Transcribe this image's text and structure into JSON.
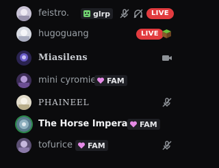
{
  "voice_users": [
    {
      "name": "feistro.",
      "tag": "glrp",
      "live": "LIVE"
    },
    {
      "name": "hugoguang",
      "live": "LIVE"
    },
    {
      "name": "Miasilens"
    },
    {
      "name": "mini cyromie",
      "tag": "FAM"
    },
    {
      "name": "PHAINEEL"
    },
    {
      "name": "The Horse Imperator",
      "tag": "FAM"
    },
    {
      "name": "tofurice",
      "tag": "FAM"
    }
  ],
  "colors": {
    "live": "#e23b3f",
    "speaking_ring": "#2b8a4a",
    "heart_tag": "#e58ae6",
    "cat_tag": "#6fcf6f"
  },
  "icons": [
    "cat-face-icon",
    "heart-icon",
    "muted-mic-icon",
    "deafened-headphones-icon",
    "camera-icon",
    "minecraft-block-icon"
  ]
}
